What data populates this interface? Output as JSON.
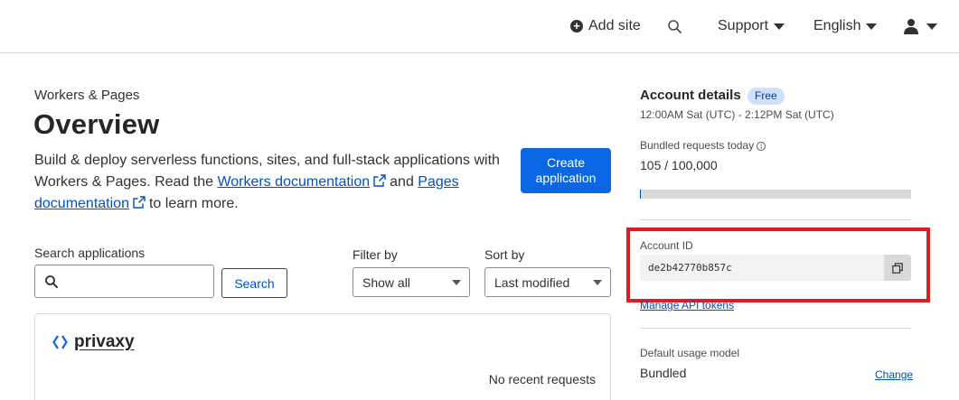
{
  "topbar": {
    "add_site": "Add site",
    "support": "Support",
    "language": "English"
  },
  "main": {
    "breadcrumb": "Workers & Pages",
    "title": "Overview",
    "desc_part1": "Build & deploy serverless functions, sites, and full-stack applications with Workers & Pages. Read the ",
    "workers_doc_link": "Workers documentation",
    "desc_and": "and ",
    "pages_doc_link": "Pages documentation",
    "desc_end": "to learn more.",
    "create_button": "Create application",
    "search_label": "Search applications",
    "search_value": "",
    "search_button": "Search",
    "filter_label": "Filter by",
    "filter_value": "Show all",
    "sort_label": "Sort by",
    "sort_value": "Last modified"
  },
  "apps": [
    {
      "name": "privaxy",
      "status": "No recent requests"
    }
  ],
  "account": {
    "title": "Account details",
    "plan_badge": "Free",
    "time_range": "12:00AM Sat (UTC) - 2:12PM Sat (UTC)",
    "bundled_label": "Bundled requests today",
    "bundled_count": "105 / 100,000",
    "usage_fraction": 0.00105,
    "account_id_label": "Account ID",
    "account_id": "de2b42770b857c",
    "manage_tokens": "Manage API tokens",
    "usage_model_label": "Default usage model",
    "usage_model": "Bundled",
    "change_link": "Change"
  },
  "colors": {
    "accent": "#0051c3",
    "primary_button": "#0b66e4",
    "highlight": "#e01b24"
  }
}
